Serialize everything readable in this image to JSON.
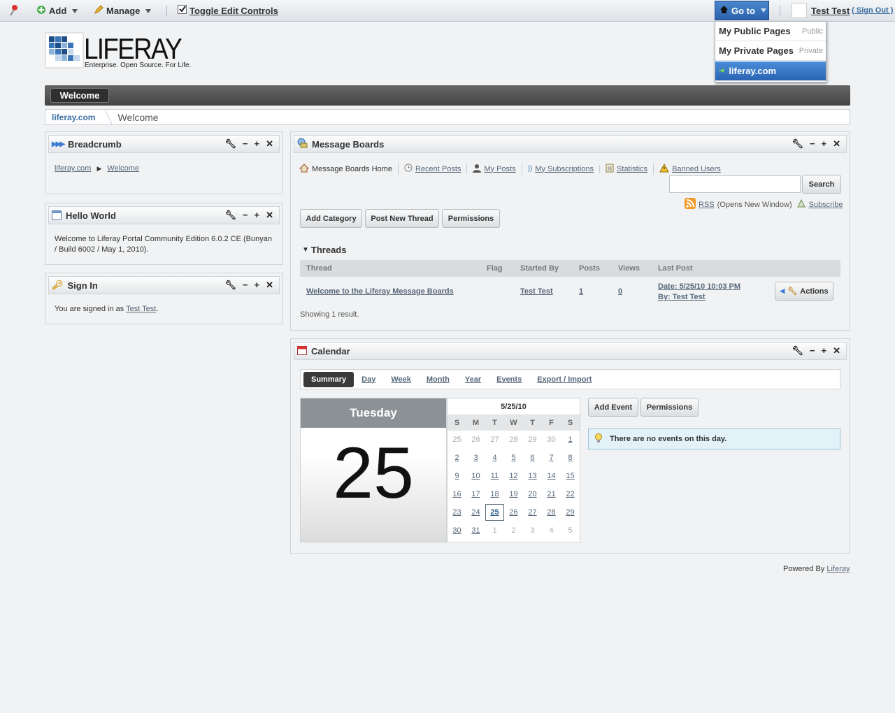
{
  "dockbar": {
    "add_label": "Add",
    "manage_label": "Manage",
    "toggle_label": "Toggle Edit Controls",
    "goto_label": "Go to",
    "user_name": "Test Test",
    "signout_label": "( Sign Out )"
  },
  "goto_menu": [
    {
      "label": "My Public Pages",
      "tag": "Public"
    },
    {
      "label": "My Private Pages",
      "tag": "Private"
    },
    {
      "label": "liferay.com",
      "tag": ""
    }
  ],
  "logo": {
    "name": "LIFERAY",
    "tagline": "Enterprise. Open Source. For Life."
  },
  "nav": {
    "welcome": "Welcome"
  },
  "breadcrumb_bar": {
    "site": "liferay.com",
    "page": "Welcome"
  },
  "portlets": {
    "breadcrumb": {
      "title": "Breadcrumb",
      "site": "liferay.com",
      "page": "Welcome"
    },
    "hello": {
      "title": "Hello World",
      "text": "Welcome to Liferay Portal Community Edition 6.0.2 CE (Bunyan / Build 6002 / May 1, 2010)."
    },
    "signin": {
      "title": "Sign In",
      "text": "You are signed in as ",
      "user": "Test Test",
      "period": "."
    }
  },
  "mb": {
    "title": "Message Boards",
    "nav": [
      "Message Boards Home",
      "Recent Posts",
      "My Posts",
      "My Subscriptions",
      "Statistics",
      "Banned Users"
    ],
    "search_button": "Search",
    "rss": "RSS",
    "rss_note": "(Opens New Window)",
    "subscribe": "Subscribe",
    "buttons": [
      "Add Category",
      "Post New Thread",
      "Permissions"
    ],
    "threads_heading": "Threads",
    "columns": [
      "Thread",
      "Flag",
      "Started By",
      "Posts",
      "Views",
      "Last Post"
    ],
    "row": {
      "thread": "Welcome to the Liferay Message Boards",
      "started_by": "Test Test",
      "posts": "1",
      "views": "0",
      "last_post_date": "Date: 5/25/10 10:03 PM",
      "last_post_by": "By: Test Test",
      "actions": "Actions"
    },
    "showing": "Showing 1 result."
  },
  "calendar": {
    "title": "Calendar",
    "tabs": [
      "Summary",
      "Day",
      "Week",
      "Month",
      "Year",
      "Events",
      "Export / Import"
    ],
    "day_name": "Tuesday",
    "day_number": "25",
    "mini_title": "5/25/10",
    "dow": [
      "S",
      "M",
      "T",
      "W",
      "T",
      "F",
      "S"
    ],
    "weeks": [
      [
        "25",
        "26",
        "27",
        "28",
        "29",
        "30",
        "1"
      ],
      [
        "2",
        "3",
        "4",
        "5",
        "6",
        "7",
        "8"
      ],
      [
        "9",
        "10",
        "11",
        "12",
        "13",
        "14",
        "15"
      ],
      [
        "16",
        "17",
        "18",
        "19",
        "20",
        "21",
        "22"
      ],
      [
        "23",
        "24",
        "25",
        "26",
        "27",
        "28",
        "29"
      ],
      [
        "30",
        "31",
        "1",
        "2",
        "3",
        "4",
        "5"
      ]
    ],
    "add_event": "Add Event",
    "permissions": "Permissions",
    "no_events": "There are no events on this day."
  },
  "footer": {
    "powered": "Powered By ",
    "link": "Liferay"
  }
}
